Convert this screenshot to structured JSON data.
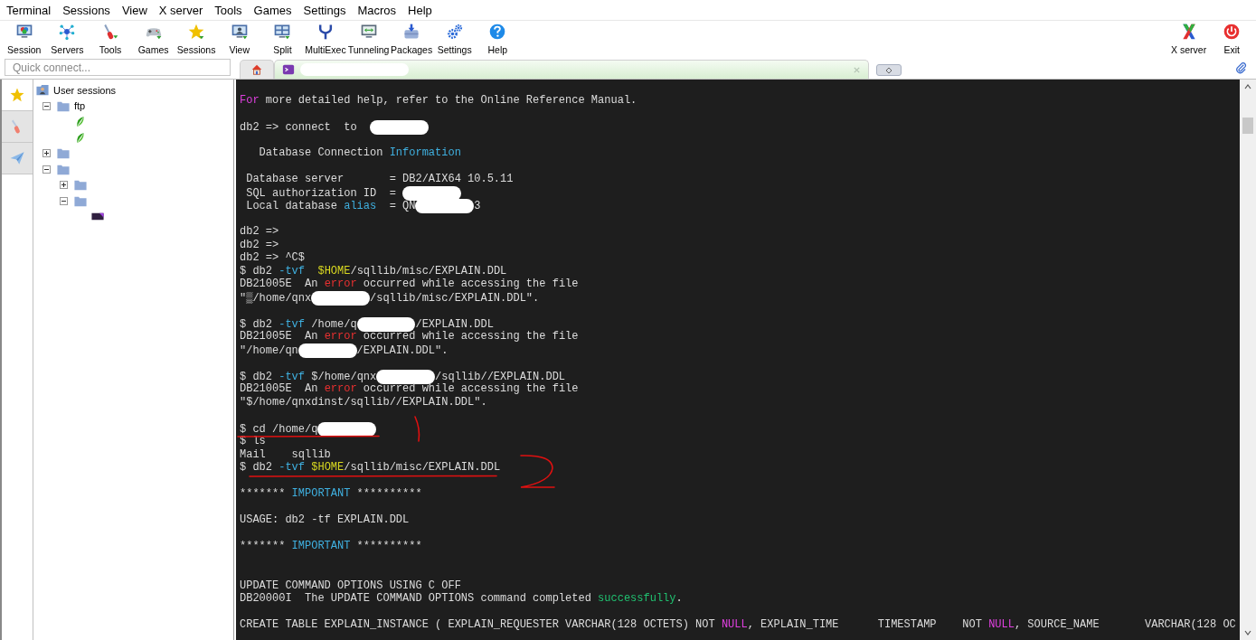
{
  "menu_bar": [
    "Terminal",
    "Sessions",
    "View",
    "X server",
    "Tools",
    "Games",
    "Settings",
    "Macros",
    "Help"
  ],
  "toolbar": {
    "left": [
      {
        "label": "Session"
      },
      {
        "label": "Servers"
      },
      {
        "label": "Tools"
      },
      {
        "label": "Games"
      },
      {
        "label": "Sessions"
      },
      {
        "label": "View"
      },
      {
        "label": "Split"
      },
      {
        "label": "MultiExec"
      },
      {
        "label": "Tunneling"
      },
      {
        "label": "Packages"
      },
      {
        "label": "Settings"
      },
      {
        "label": "Help"
      }
    ],
    "right": [
      {
        "label": "X server"
      },
      {
        "label": "Exit"
      }
    ]
  },
  "quick_connect": {
    "placeholder": "Quick connect..."
  },
  "tabs": [
    {
      "kind": "home",
      "selected": false
    },
    {
      "kind": "session",
      "selected": true,
      "title_redacted": true
    }
  ],
  "side_tabs": [
    {
      "selected": true
    },
    {
      "selected": false
    },
    {
      "selected": false
    }
  ],
  "tree": [
    {
      "label": "User sessions",
      "kind": "root",
      "children": [
        {
          "label": "ftp",
          "kind": "folder",
          "expanded": true,
          "children": [
            {
              "kind": "session"
            },
            {
              "kind": "session"
            }
          ]
        },
        {
          "kind": "folder",
          "expanded": false
        },
        {
          "kind": "folder",
          "expanded": true,
          "children": [
            {
              "kind": "folder",
              "expanded": false
            },
            {
              "kind": "folder",
              "expanded": true,
              "children": [
                {
                  "kind": "item"
                }
              ]
            }
          ]
        }
      ]
    }
  ],
  "terminal": {
    "lines": [
      {
        "kind": "text",
        "segments": [
          {
            "text": "For",
            "color": "#e040e0"
          },
          {
            "text": " more detailed help, refer to the Online Reference Manual."
          }
        ]
      },
      {
        "kind": "blank"
      },
      {
        "kind": "text",
        "segments": [
          {
            "text": "db2 => connect  to  "
          },
          {
            "kind": "redacted"
          }
        ]
      },
      {
        "kind": "blank"
      },
      {
        "kind": "text",
        "segments": [
          {
            "text": "   Database Connection "
          },
          {
            "text": "Information",
            "color": "#3fb0e0"
          }
        ]
      },
      {
        "kind": "blank"
      },
      {
        "kind": "text",
        "segments": [
          {
            "text": " Database server       = DB2/AIX64 10.5.11"
          }
        ]
      },
      {
        "kind": "text",
        "segments": [
          {
            "text": " SQL authorization ID  = "
          },
          {
            "kind": "redacted"
          }
        ]
      },
      {
        "kind": "text",
        "segments": [
          {
            "text": " Local database "
          },
          {
            "text": "alias",
            "color": "#3fb0e0"
          },
          {
            "text": "  = QN"
          },
          {
            "kind": "redacted"
          },
          {
            "text": "3"
          }
        ]
      },
      {
        "kind": "blank"
      },
      {
        "kind": "text",
        "segments": [
          {
            "text": "db2 =>"
          }
        ]
      },
      {
        "kind": "text",
        "segments": [
          {
            "text": "db2 =>"
          }
        ]
      },
      {
        "kind": "text",
        "segments": [
          {
            "text": "db2 => ^C$"
          }
        ]
      },
      {
        "kind": "text",
        "segments": [
          {
            "text": "$ db2 "
          },
          {
            "text": "-tvf",
            "color": "#3fb0e0"
          },
          {
            "text": "  $HOME",
            "color": "#d8d820"
          },
          {
            "text": "/sqllib/misc/EXPLAIN.DDL"
          }
        ]
      },
      {
        "kind": "text",
        "segments": [
          {
            "text": "DB21005E  An "
          },
          {
            "text": "error",
            "color": "#e83030"
          },
          {
            "text": " occurred while accessing the file"
          }
        ]
      },
      {
        "kind": "text",
        "segments": [
          {
            "text": "\"▒/home/qnx"
          },
          {
            "kind": "redacted"
          },
          {
            "text": "/sqllib/misc/EXPLAIN.DDL\"."
          }
        ]
      },
      {
        "kind": "blank"
      },
      {
        "kind": "text",
        "segments": [
          {
            "text": "$ db2 "
          },
          {
            "text": "-tvf",
            "color": "#3fb0e0"
          },
          {
            "text": " /home/q"
          },
          {
            "kind": "redacted"
          },
          {
            "text": "/EXPLAIN.DDL"
          }
        ]
      },
      {
        "kind": "text",
        "segments": [
          {
            "text": "DB21005E  An "
          },
          {
            "text": "error",
            "color": "#e83030"
          },
          {
            "text": " occurred while accessing the file"
          }
        ]
      },
      {
        "kind": "text",
        "segments": [
          {
            "text": "\"/home/qn"
          },
          {
            "kind": "redacted"
          },
          {
            "text": "/EXPLAIN.DDL\"."
          }
        ]
      },
      {
        "kind": "blank"
      },
      {
        "kind": "text",
        "segments": [
          {
            "text": "$ db2 "
          },
          {
            "text": "-tvf",
            "color": "#3fb0e0"
          },
          {
            "text": " $/home/qnx"
          },
          {
            "kind": "redacted"
          },
          {
            "text": "/sqllib//EXPLAIN.DDL"
          }
        ]
      },
      {
        "kind": "text",
        "segments": [
          {
            "text": "DB21005E  An "
          },
          {
            "text": "error",
            "color": "#e83030"
          },
          {
            "text": " occurred while accessing the file"
          }
        ]
      },
      {
        "kind": "text",
        "segments": [
          {
            "text": "\"$/home/qnxdinst/sqllib//EXPLAIN.DDL\"."
          }
        ]
      },
      {
        "kind": "blank"
      },
      {
        "kind": "text",
        "segments": [
          {
            "text": "$ cd /home/q"
          },
          {
            "kind": "redacted"
          }
        ]
      },
      {
        "kind": "text",
        "segments": [
          {
            "text": "$ ls"
          }
        ]
      },
      {
        "kind": "text",
        "segments": [
          {
            "text": "Mail    sqllib"
          }
        ]
      },
      {
        "kind": "text",
        "segments": [
          {
            "text": "$ db2 "
          },
          {
            "text": "-tvf",
            "color": "#3fb0e0"
          },
          {
            "text": " $HOME",
            "color": "#d8d820"
          },
          {
            "text": "/sqllib/misc/EXPLAIN.DDL"
          }
        ]
      },
      {
        "kind": "blank"
      },
      {
        "kind": "text",
        "segments": [
          {
            "text": "******* "
          },
          {
            "text": "IMPORTANT",
            "color": "#3fb0e0"
          },
          {
            "text": " **********"
          }
        ]
      },
      {
        "kind": "blank"
      },
      {
        "kind": "text",
        "segments": [
          {
            "text": "USAGE: db2 -tf EXPLAIN.DDL"
          }
        ]
      },
      {
        "kind": "blank"
      },
      {
        "kind": "text",
        "segments": [
          {
            "text": "******* "
          },
          {
            "text": "IMPORTANT",
            "color": "#3fb0e0"
          },
          {
            "text": " **********"
          }
        ]
      },
      {
        "kind": "blank"
      },
      {
        "kind": "blank"
      },
      {
        "kind": "text",
        "segments": [
          {
            "text": "UPDATE COMMAND OPTIONS USING C OFF"
          }
        ]
      },
      {
        "kind": "text",
        "segments": [
          {
            "text": "DB20000I  The UPDATE COMMAND OPTIONS command completed "
          },
          {
            "text": "successfully",
            "color": "#20c070"
          },
          {
            "text": "."
          }
        ]
      },
      {
        "kind": "blank"
      },
      {
        "kind": "text",
        "segments": [
          {
            "text": "CREATE TABLE EXPLAIN_INSTANCE ( EXPLAIN_REQUESTER VARCHAR(128 OCTETS) NOT "
          },
          {
            "text": "NULL",
            "color": "#e040e0"
          },
          {
            "text": ", EXPLAIN_TIME      TIMESTAMP    NOT "
          },
          {
            "text": "NULL",
            "color": "#e040e0"
          },
          {
            "text": ", SOURCE_NAME       VARCHAR(128 OC"
          }
        ]
      }
    ],
    "annotations": true
  }
}
